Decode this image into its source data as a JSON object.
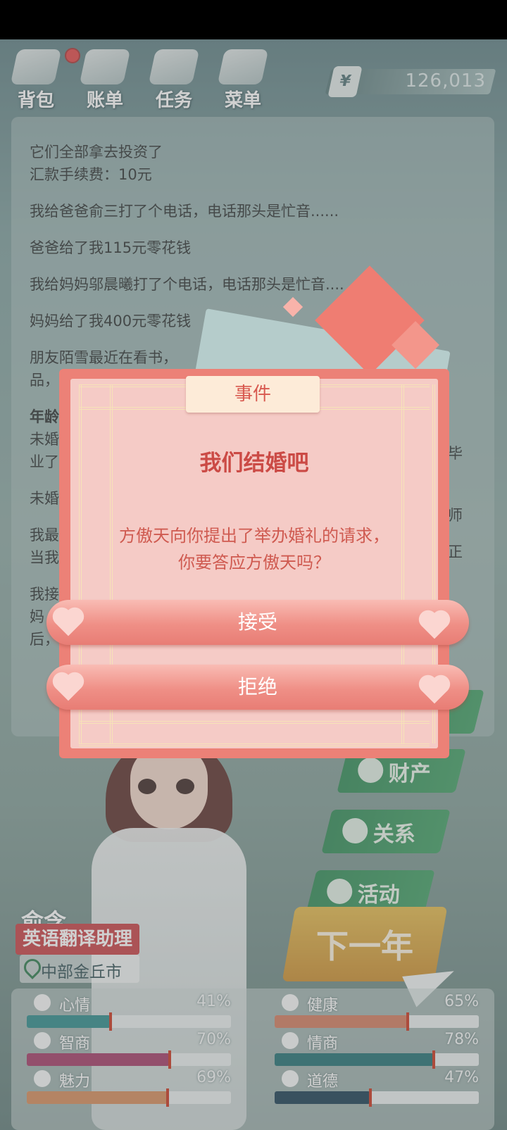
{
  "toolbar": {
    "bag": "背包",
    "bill": "账单",
    "task": "任务",
    "menu": "菜单",
    "money_symbol": "¥",
    "money_value": "126,013"
  },
  "log": {
    "lines": [
      "它们全部拿去投资了",
      "汇款手续费：10元",
      "我给爸爸俞三打了个电话，电话那头是忙音......",
      "爸爸给了我115元零花钱",
      "我给妈妈邬晨曦打了个电话，电话那头是忙音....",
      "妈妈给了我400元零花钱",
      "朋友陌雪最近在看书，",
      "品，",
      "年龄",
      "未婚",
      "业了",
      "未婚",
      "我最",
      "当我",
      "我接",
      "妈",
      "后，"
    ],
    "right_fragments": [
      "毕",
      "师",
      "正"
    ]
  },
  "side": {
    "property": "财产",
    "relation": "关系",
    "activity": "活动",
    "next_year": "下一年"
  },
  "character": {
    "name": "俞含",
    "job": "英语翻译助理",
    "location": "中部金丘市"
  },
  "stats": [
    {
      "label": "心情",
      "value": "41%",
      "level": 0.41,
      "color": "#2c8b8b"
    },
    {
      "label": "健康",
      "value": "65%",
      "level": 0.65,
      "color": "#d17b5f"
    },
    {
      "label": "智商",
      "value": "70%",
      "level": 0.7,
      "color": "#a13a66"
    },
    {
      "label": "情商",
      "value": "78%",
      "level": 0.78,
      "color": "#1f6f72"
    },
    {
      "label": "魅力",
      "value": "69%",
      "level": 0.69,
      "color": "#d48a59"
    },
    {
      "label": "道德",
      "value": "47%",
      "level": 0.47,
      "color": "#173d52"
    }
  ],
  "dialog": {
    "tag": "事件",
    "title": "我们结婚吧",
    "message": "方傲天向你提出了举办婚礼的请求，你要答应方傲天吗？",
    "accept": "接受",
    "reject": "拒绝"
  }
}
